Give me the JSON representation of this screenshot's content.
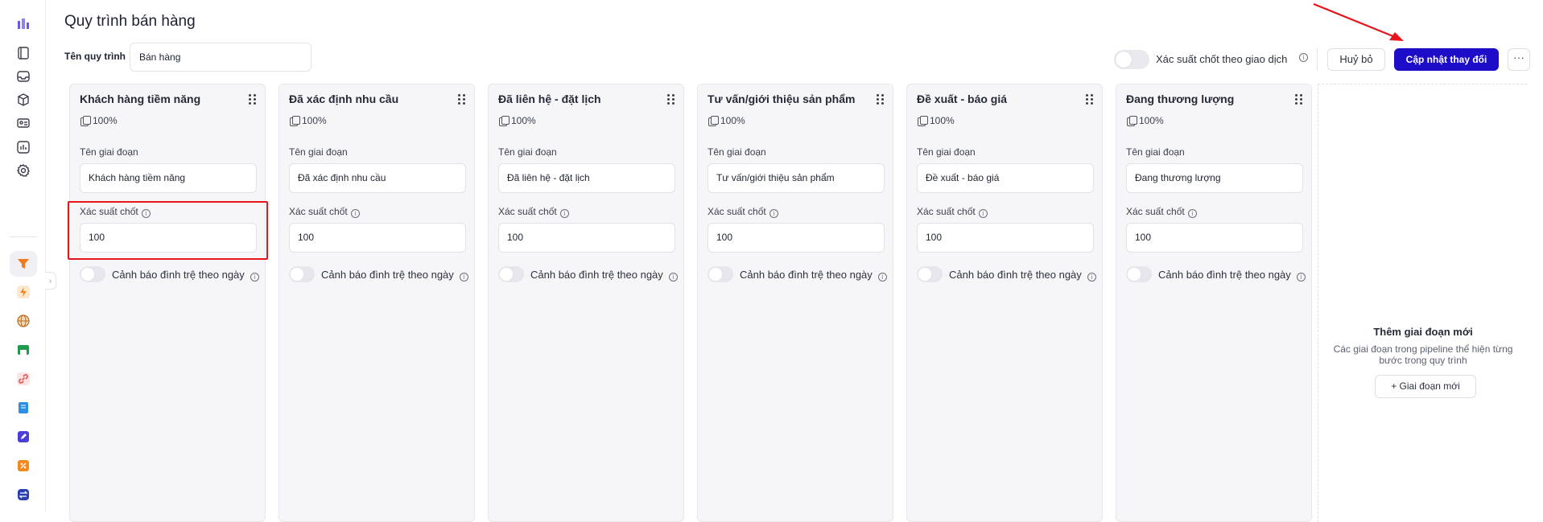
{
  "page": {
    "title": "Quy trình bán hàng"
  },
  "process": {
    "name_label": "Tên quy trình",
    "name_value": "Bán hàng"
  },
  "header": {
    "toggle_label": "Xác suất chốt theo giao dịch",
    "cancel_label": "Huỷ bỏ",
    "update_label": "Cập nhật thay đổi",
    "more_label": "···"
  },
  "colors": {
    "primary": "#1e0dc8",
    "annotation": "#e8141b"
  },
  "stage_fields": {
    "name_label": "Tên giai đoạn",
    "prob_label": "Xác suất chốt",
    "warn_label": "Cảnh báo đình trệ theo ngày"
  },
  "stages": [
    {
      "title": "Khách hàng tiềm năng",
      "percent": "100%",
      "name": "Khách hàng tiềm năng",
      "probability": "100"
    },
    {
      "title": "Đã xác định nhu cầu",
      "percent": "100%",
      "name": "Đã xác định nhu cầu",
      "probability": "100"
    },
    {
      "title": "Đã liên hệ - đặt lịch",
      "percent": "100%",
      "name": "Đã liên hệ - đặt lịch",
      "probability": "100"
    },
    {
      "title": "Tư vấn/giới thiệu sản phẩm",
      "percent": "100%",
      "name": "Tư vấn/giới thiệu sản phẩm",
      "probability": "100"
    },
    {
      "title": "Đề xuất - báo giá",
      "percent": "100%",
      "name": "Đề xuất - báo giá",
      "probability": "100"
    },
    {
      "title": "Đang thương lượng",
      "percent": "100%",
      "name": "Đang thương lượng",
      "probability": "100"
    }
  ],
  "add_stage": {
    "title": "Thêm giai đoạn mới",
    "description": "Các giai đoạn trong pipeline thể hiện từng bước trong quy trình",
    "button_label": "+ Giai đoạn mới"
  },
  "sidebar": {
    "icons": [
      "logo-icon",
      "notebook-icon",
      "inbox-icon",
      "box-icon",
      "contact-card-icon",
      "chart-icon",
      "settings-icon",
      "funnel-icon",
      "lightning-icon",
      "globe-icon",
      "store-icon",
      "link-icon",
      "book-icon",
      "edit-icon",
      "discount-icon",
      "exchange-icon"
    ]
  }
}
